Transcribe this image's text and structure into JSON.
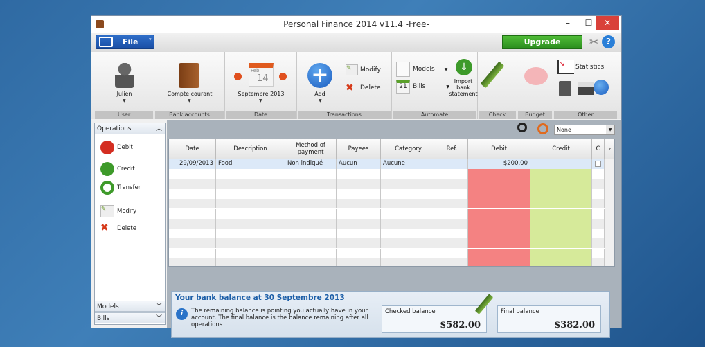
{
  "window": {
    "title": "Personal Finance 2014 v11.4 -Free-",
    "minimize": "–",
    "maximize": "☐",
    "close": "✕"
  },
  "filebar": {
    "file": "File",
    "upgrade": "Upgrade"
  },
  "ribbon": {
    "user": {
      "name": "Julien",
      "group": "User"
    },
    "bank": {
      "name": "Compte courant",
      "group": "Bank accounts"
    },
    "date": {
      "month": "Feb",
      "day": "14",
      "value": "Septembre 2013",
      "group": "Date"
    },
    "transactions": {
      "add": "Add",
      "modify": "Modify",
      "delete": "Delete",
      "group": "Transactions"
    },
    "automate": {
      "models": "Models",
      "bills": "Bills",
      "bills_day": "21",
      "import": "Import bank statement",
      "group": "Automate"
    },
    "check": {
      "group": "Check"
    },
    "budget": {
      "group": "Budget"
    },
    "other": {
      "statistics": "Statistics",
      "group": "Other"
    }
  },
  "sidebar": {
    "header": "Operations",
    "items": [
      {
        "label": "Debit"
      },
      {
        "label": "Credit"
      },
      {
        "label": "Transfer"
      },
      {
        "label": "Modify"
      },
      {
        "label": "Delete"
      }
    ],
    "models": "Models",
    "bills": "Bills"
  },
  "filter": {
    "selected": "None"
  },
  "table": {
    "columns": [
      "Date",
      "Description",
      "Method of payment",
      "Payees",
      "Category",
      "Ref.",
      "Debit",
      "Credit",
      "C"
    ],
    "rows": [
      [
        "29/09/2013",
        "Food",
        "Non indiqué",
        "Aucun",
        "Aucune",
        "",
        "$200.00",
        "",
        ""
      ]
    ]
  },
  "balance": {
    "title": "Your bank balance at 30 Septembre 2013",
    "info": "The remaining balance is pointing you actually have in your account. The final balance is the balance remaining after all operations",
    "checked_label": "Checked balance",
    "checked_value": "$582.00",
    "final_label": "Final balance",
    "final_value": "$382.00"
  },
  "colors": {
    "debit": "#f48282",
    "credit": "#d6ea9a",
    "accent": "#1a4fa6",
    "upgrade": "#3aa52a"
  }
}
